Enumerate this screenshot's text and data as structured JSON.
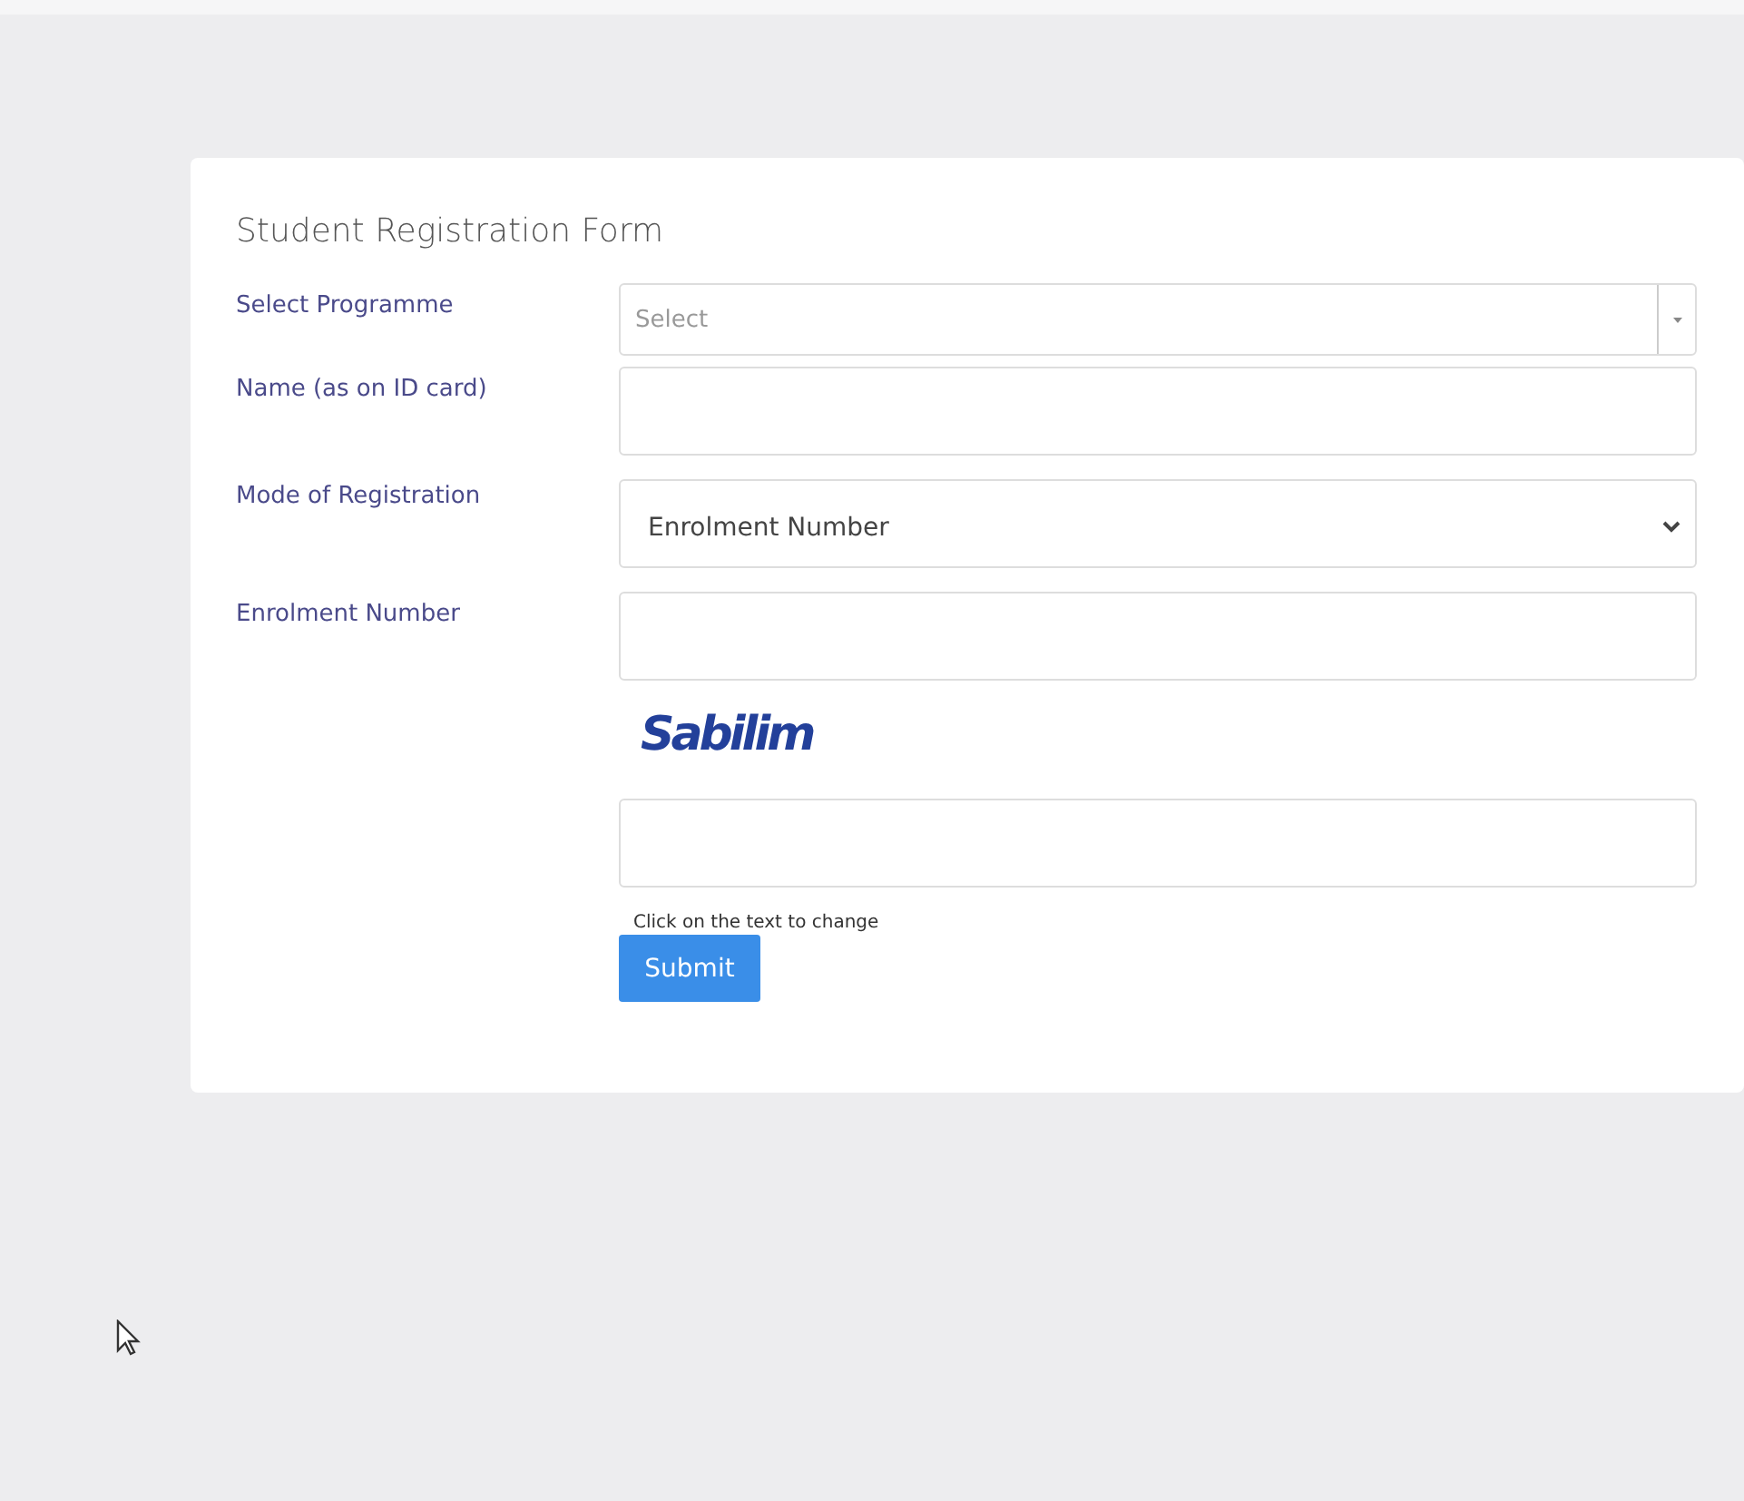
{
  "form": {
    "title": "Student Registration Form",
    "fields": [
      {
        "kind": "combo",
        "label": "Select Programme",
        "placeholder": "Select"
      },
      {
        "kind": "text",
        "label": "Name (as on ID card)"
      },
      {
        "kind": "select",
        "label": "Mode of Registration",
        "value": "Enrolment Number"
      },
      {
        "kind": "text",
        "label": "Enrolment Number"
      }
    ],
    "captcha": {
      "text": "Sabilim",
      "hint": "Click on the text to change"
    },
    "submit": "Submit"
  }
}
